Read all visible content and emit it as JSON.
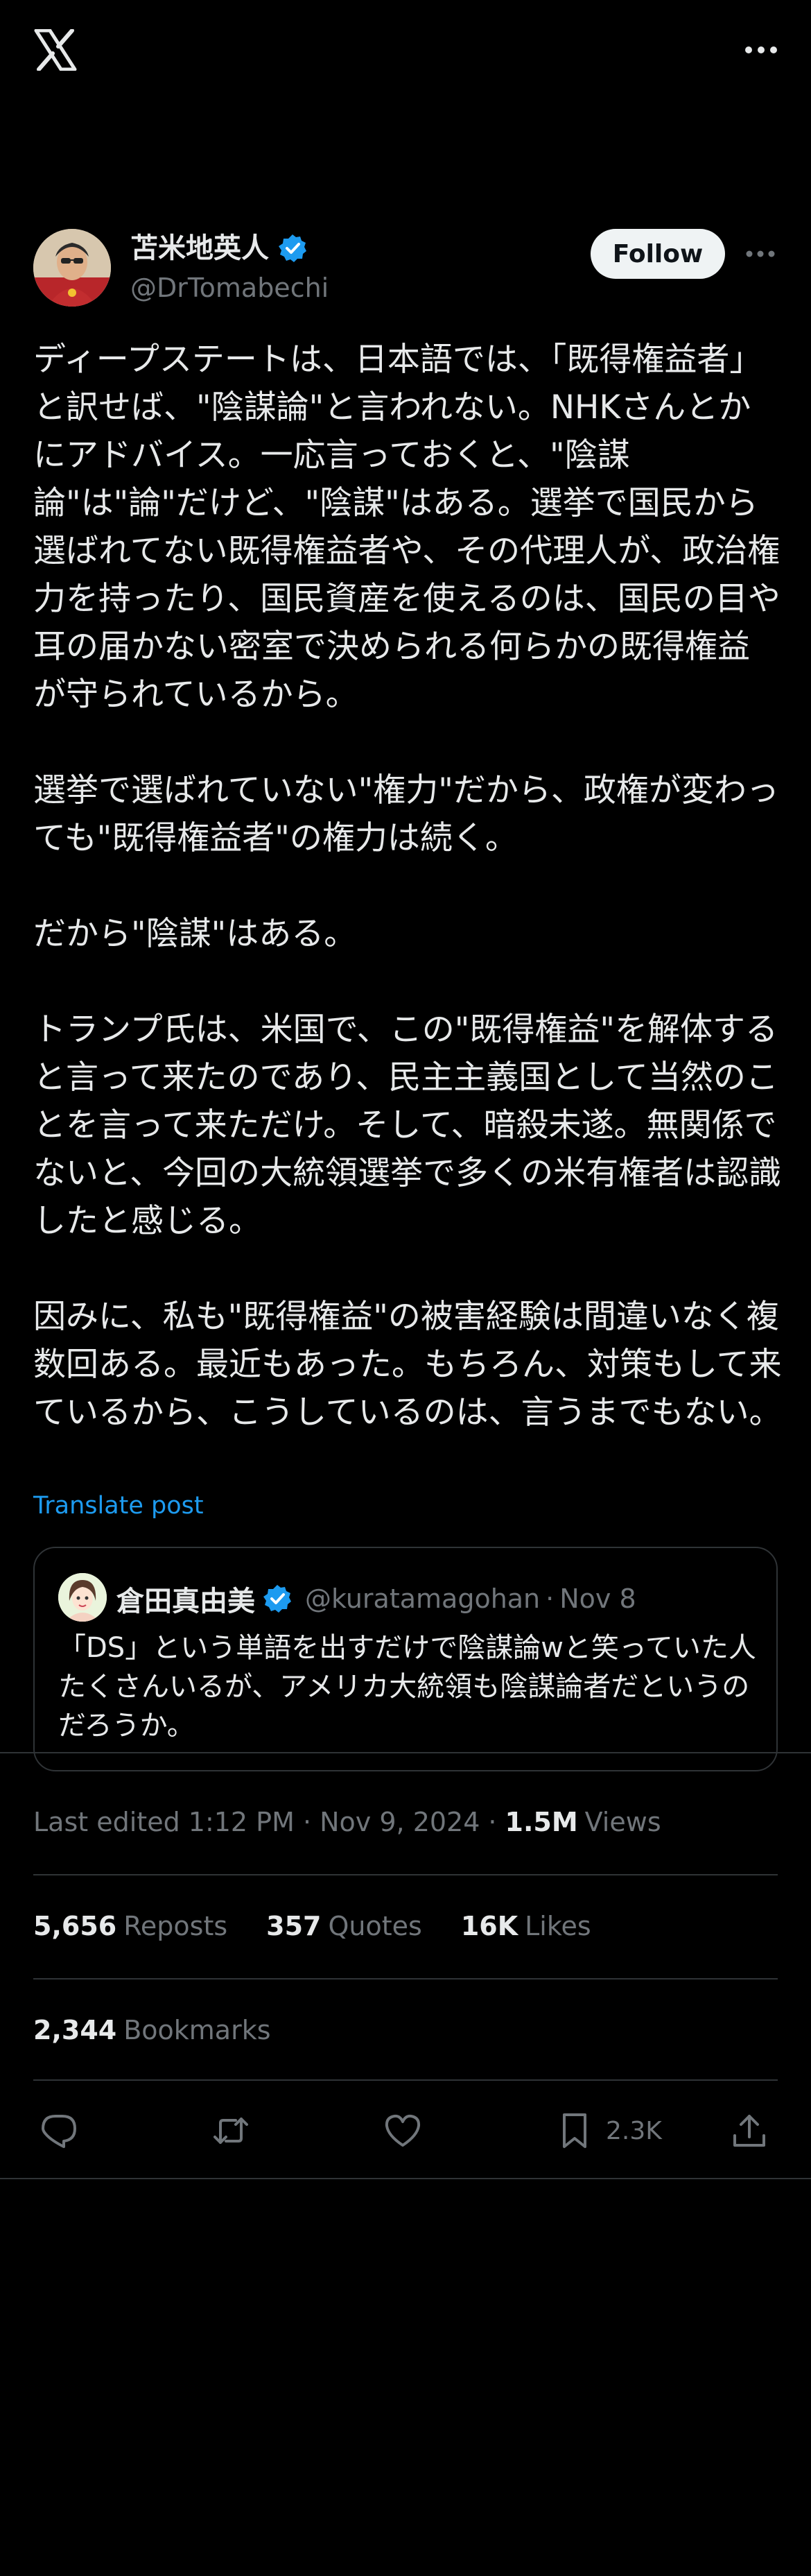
{
  "author": {
    "display_name": "苫米地英人",
    "handle": "@DrTomabechi",
    "follow_label": "Follow"
  },
  "tweet": {
    "text": "ディープステートは、日本語では、「既得権益者」と訳せば、\"陰謀論\"と言われない。NHKさんとかにアドバイス。一応言っておくと、\"陰謀\n論\"は\"論\"だけど、\"陰謀\"はある。選挙で国民から選ばれてない既得権益者や、その代理人が、政治権力を持ったり、国民資産を使えるのは、国民の目や耳の届かない密室で決められる何らかの既得権益が守られているから。\n\n選挙で選ばれていない\"権力\"だから、政権が変わっても\"既得権益者\"の権力は続く。\n\nだから\"陰謀\"はある。\n\nトランプ氏は、米国で、この\"既得権益\"を解体すると言って来たのであり、民主主義国として当然のことを言って来ただけ。そして、暗殺未遂。無関係でないと、今回の大統領選挙で多くの米有権者は認識したと感じる。\n\n因みに、私も\"既得権益\"の被害経験は間違いなく複数回ある。最近もあった。もちろん、対策もして来ているから、こうしているのは、言うまでもない。",
    "translate_label": "Translate post"
  },
  "quote": {
    "display_name": "倉田真由美",
    "handle": "@kuratamagohan",
    "separator": "·",
    "date": "Nov 8",
    "text": "「DS」という単語を出すだけで陰謀論wと笑っていた人たくさんいるが、アメリカ大統領も陰謀論者だというのだろうか。"
  },
  "meta": {
    "edited": "Last edited 1:12 PM · Nov 9, 2024",
    "separator": "·",
    "views_count": "1.5M",
    "views_label": "Views"
  },
  "stats": {
    "reposts_count": "5,656",
    "reposts_label": "Reposts",
    "quotes_count": "357",
    "quotes_label": "Quotes",
    "likes_count": "16K",
    "likes_label": "Likes",
    "bookmarks_count": "2,344",
    "bookmarks_label": "Bookmarks"
  },
  "actions": {
    "bookmark_count": "2.3K"
  },
  "icons": {
    "logo": "x-logo-icon",
    "more": "more-horizontal-icon",
    "verified": "verified-badge-icon",
    "reply": "reply-icon",
    "repost": "repost-icon",
    "like": "heart-icon",
    "bookmark": "bookmark-icon",
    "share": "share-icon"
  },
  "colors": {
    "background": "#000000",
    "text": "#e7e9ea",
    "muted": "#71767b",
    "accent": "#1d9bf0",
    "divider": "#2f3336"
  }
}
